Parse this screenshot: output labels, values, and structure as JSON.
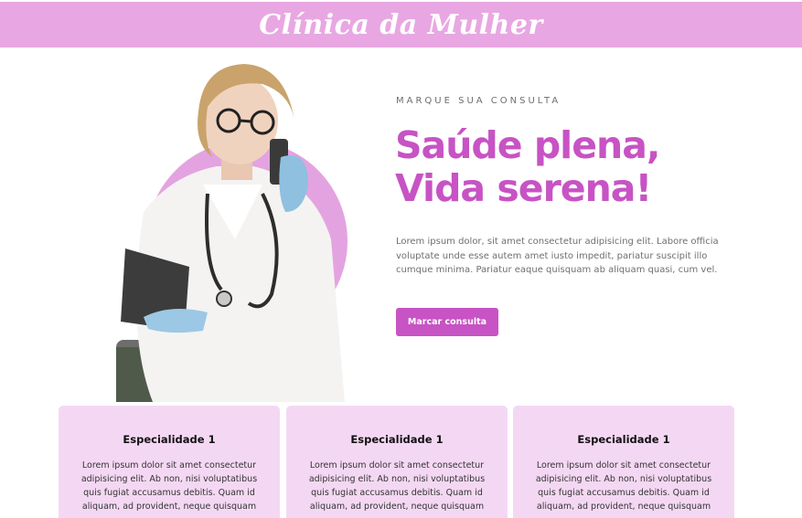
{
  "header": {
    "brand": "Clínica da Mulher"
  },
  "hero": {
    "eyebrow": "MARQUE SUA CONSULTA",
    "headline_line1": "Saúde plena,",
    "headline_line2": "Vida serena!",
    "lead": "Lorem ipsum dolor, sit amet consectetur adipisicing elit. Labore officia voluptate unde esse autem amet iusto impedit, pariatur suscipit illo cumque minima. Pariatur eaque quisquam ab aliquam quasi, cum vel.",
    "cta_label": "Marcar consulta"
  },
  "cards": [
    {
      "title": "Especialidade 1",
      "text": "Lorem ipsum dolor sit amet consectetur adipisicing elit. Ab non, nisi voluptatibus quis fugiat accusamus debitis. Quam id aliquam, ad provident, neque quisquam"
    },
    {
      "title": "Especialidade 1",
      "text": "Lorem ipsum dolor sit amet consectetur adipisicing elit. Ab non, nisi voluptatibus quis fugiat accusamus debitis. Quam id aliquam, ad provident, neque quisquam"
    },
    {
      "title": "Especialidade 1",
      "text": "Lorem ipsum dolor sit amet consectetur adipisicing elit. Ab non, nisi voluptatibus quis fugiat accusamus debitis. Quam id aliquam, ad provident, neque quisquam"
    }
  ],
  "colors": {
    "header_bg": "#e8a7e2",
    "accent": "#c753c4",
    "card_bg": "#f4d8f3"
  }
}
